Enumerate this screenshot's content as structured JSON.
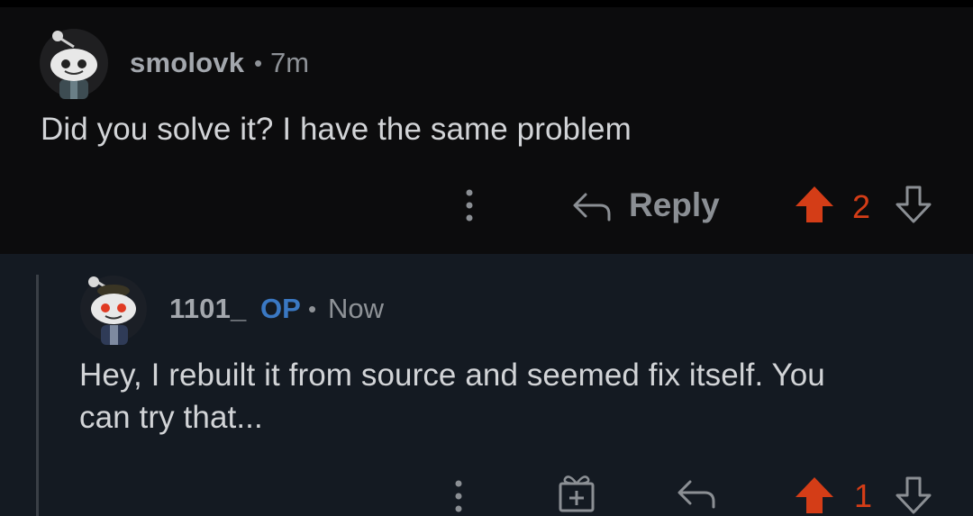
{
  "comments": [
    {
      "username": "smolovk",
      "separator": "•",
      "time": "7m",
      "body": "Did you solve it? I have the same problem",
      "actions": {
        "more_icon": "more-vertical-icon",
        "reply_icon": "reply-arrow-icon",
        "reply_label": "Reply",
        "upvote_icon": "upvote-arrow-icon",
        "score": "2",
        "downvote_icon": "downvote-arrow-icon"
      }
    },
    {
      "username": "1101_",
      "op_badge": "OP",
      "separator": "•",
      "time": "Now",
      "body_line1": "Hey, I rebuilt it from source and seemed fix itself. You",
      "body_line2": "can try that...",
      "actions": {
        "more_icon": "more-vertical-icon",
        "award_icon": "gift-award-icon",
        "reply_icon": "reply-arrow-icon",
        "upvote_icon": "upvote-arrow-icon",
        "score": "1",
        "downvote_icon": "downvote-arrow-icon"
      }
    }
  ],
  "colors": {
    "background_top": "#0c0c0d",
    "background_reply": "#141a22",
    "upvote_orange": "#d43d17",
    "op_blue": "#3a78c3",
    "muted_text": "#8e9297"
  }
}
